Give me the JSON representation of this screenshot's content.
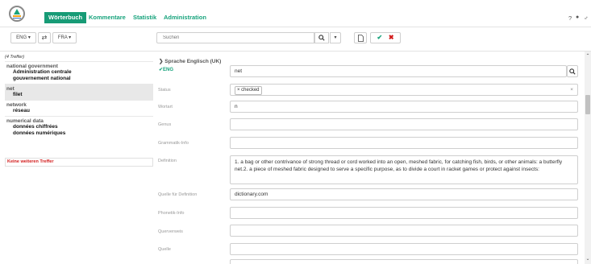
{
  "nav": {
    "items": [
      "Wörterbuch",
      "Kommentare",
      "Statistik",
      "Administration"
    ],
    "help": "?",
    "globe": "●",
    "user": "♂"
  },
  "toolbar": {
    "source_lang": "ENG ▾",
    "swap": "⇄",
    "target_lang": "FRA ▾",
    "search_placeholder": "Suchen",
    "search_icon": "🔍",
    "dropdown": "▾",
    "new_icon": "□",
    "ok_icon": "✔",
    "cancel_icon": "✖"
  },
  "results": {
    "count": "(4 Treffer)",
    "entries": [
      {
        "src": "national government",
        "targets": [
          "Administration centrale",
          "gouvernement national"
        ]
      },
      {
        "src": "net",
        "targets": [
          "filet"
        ]
      },
      {
        "src": "network",
        "targets": [
          "réseau"
        ]
      },
      {
        "src": "numerical data",
        "targets": [
          "données chiffrées",
          "données numériques"
        ]
      }
    ],
    "no_more": "Keine weiteren Treffer"
  },
  "form": {
    "lang_header": "Sprache  Englisch (UK)",
    "lang_code": "ENG",
    "term_value": "net",
    "labels": {
      "status": "Status",
      "wortart": "Wortart",
      "genus": "Genus",
      "grammatik": "Grammatik-Info",
      "definition": "Definition",
      "quelle_def": "Quelle für Definition",
      "phonetik": "Phonetik-Info",
      "querverweis": "Querverweis",
      "quelle": "Quelle"
    },
    "status_chip": "× checked",
    "status_clear": "×",
    "wortart_value": "n",
    "definition_value": "1. a bag or other contrivance of strong thread or cord worked into an open, meshed fabric, for catching fish, birds, or other animals: a butterfly net.2. a piece of meshed fabric designed to serve a specific purpose, as to divide a court in racket games or protect against insects:",
    "quelle_def_value": "dictionary.com"
  },
  "colors": {
    "accent": "#179b76",
    "danger": "#d21a1a"
  }
}
